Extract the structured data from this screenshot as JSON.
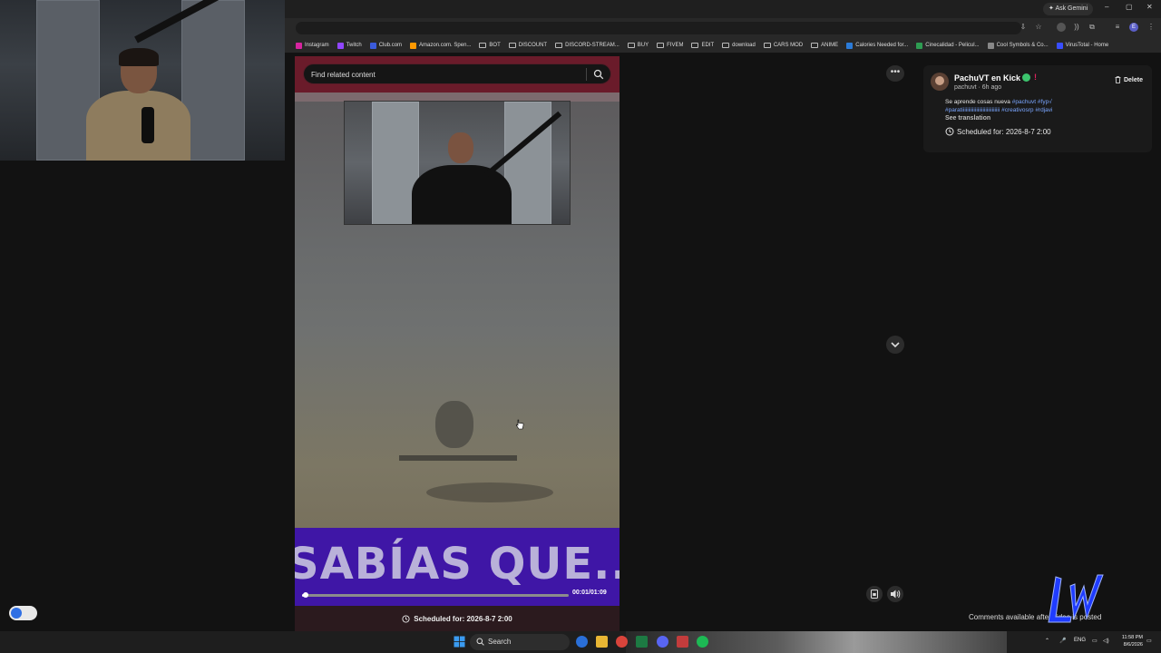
{
  "browser": {
    "ask_gemini": "Ask Gemini",
    "window_controls": [
      "–",
      "▢",
      "✕"
    ],
    "bookmarks": [
      {
        "label": "Instagram",
        "kind": "site",
        "color": "#d6249f"
      },
      {
        "label": "Twitch",
        "kind": "site",
        "color": "#9146ff"
      },
      {
        "label": "Club.com",
        "kind": "site",
        "color": "#3b5bdb"
      },
      {
        "label": "Amazon.com. Spen...",
        "kind": "site",
        "color": "#ff9900"
      },
      {
        "label": "BOT",
        "kind": "folder"
      },
      {
        "label": "DISCOUNT",
        "kind": "folder"
      },
      {
        "label": "DISCORD-STREAM...",
        "kind": "folder"
      },
      {
        "label": "BUY",
        "kind": "folder"
      },
      {
        "label": "FIVEM",
        "kind": "folder"
      },
      {
        "label": "EDIT",
        "kind": "folder"
      },
      {
        "label": "download",
        "kind": "folder"
      },
      {
        "label": "CARS MOD",
        "kind": "folder"
      },
      {
        "label": "ANIME",
        "kind": "folder"
      },
      {
        "label": "Calories Needed for...",
        "kind": "site",
        "color": "#2b7bd8"
      },
      {
        "label": "Cinecalidad - Pelicul...",
        "kind": "site",
        "color": "#2e9c52"
      },
      {
        "label": "Cool Symbols & Co...",
        "kind": "site",
        "color": "#888888"
      },
      {
        "label": "VirusTotal - Home",
        "kind": "site",
        "color": "#394eff"
      }
    ]
  },
  "search": {
    "placeholder": "Find related content"
  },
  "video": {
    "overlay_text": "SABÍAS QUE...",
    "time": "00:01/01:09",
    "progress": 0.015,
    "scheduled_bar": "Scheduled for: 2026-8-7 2:00"
  },
  "post": {
    "author": "PachuVT en Kick",
    "author_flag": "!",
    "meta": "pachuvt · 6h ago",
    "delete_label": "Delete",
    "caption_text": "Se aprende cosas nueva ",
    "hashtags_line1": "#pachuvt #fyp√",
    "hashtags_line2": "#paratiiiiiiiiiiiiiiiiiiiiiiiiiiiii #creativosrp #rdjavi",
    "see_translation": "See translation",
    "scheduled": "Scheduled for: 2026-8-7 2:00"
  },
  "comments_note": "Comments available after video is posted",
  "taskbar": {
    "search_label": "Search",
    "language": "ENG",
    "time": "11:58 PM",
    "date": "8/6/2026"
  },
  "colors": {
    "accent_red": "#6a1b2a",
    "banner_purple": "#3f16a6",
    "verified_green": "#3cc46d",
    "hashtag_blue": "#7aa6ff"
  },
  "icons": [
    "search-icon",
    "more-icon",
    "chevron-down-icon",
    "trash-icon",
    "clock-icon",
    "volume-icon",
    "caption-icon",
    "star-icon",
    "extensions-icon",
    "windows-icon"
  ]
}
